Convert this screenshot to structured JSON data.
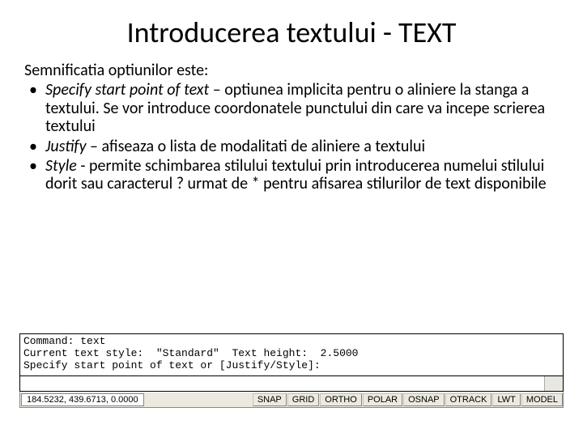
{
  "title": "Introducerea textului - TEXT",
  "intro": "Semnificatia optiunilor este:",
  "bullets": {
    "b1_italic": "Specify start point of  text",
    "b1_rest": " – optiunea implicita pentru o aliniere la stanga a textului. Se vor introduce coordonatele punctului din care va incepe scrierea textului",
    "b2_italic": "Justify",
    "b2_rest": " – afiseaza o lista de modalitati de aliniere a textului",
    "b3_italic": "Style ",
    "b3_rest": " - permite schimbarea stilului textului prin introducerea numelui stilului dorit sau caracterul ? urmat de * pentru afisarea stilurilor de text disponibile"
  },
  "command": {
    "line1": "Command: text",
    "line2": "Current text style:  \"Standard\"  Text height:  2.5000",
    "line3": "Specify start point of text or [Justify/Style]:"
  },
  "status": {
    "coords": "184.5232, 439.6713, 0.0000",
    "buttons": [
      "SNAP",
      "GRID",
      "ORTHO",
      "POLAR",
      "OSNAP",
      "OTRACK",
      "LWT",
      "MODEL"
    ]
  }
}
